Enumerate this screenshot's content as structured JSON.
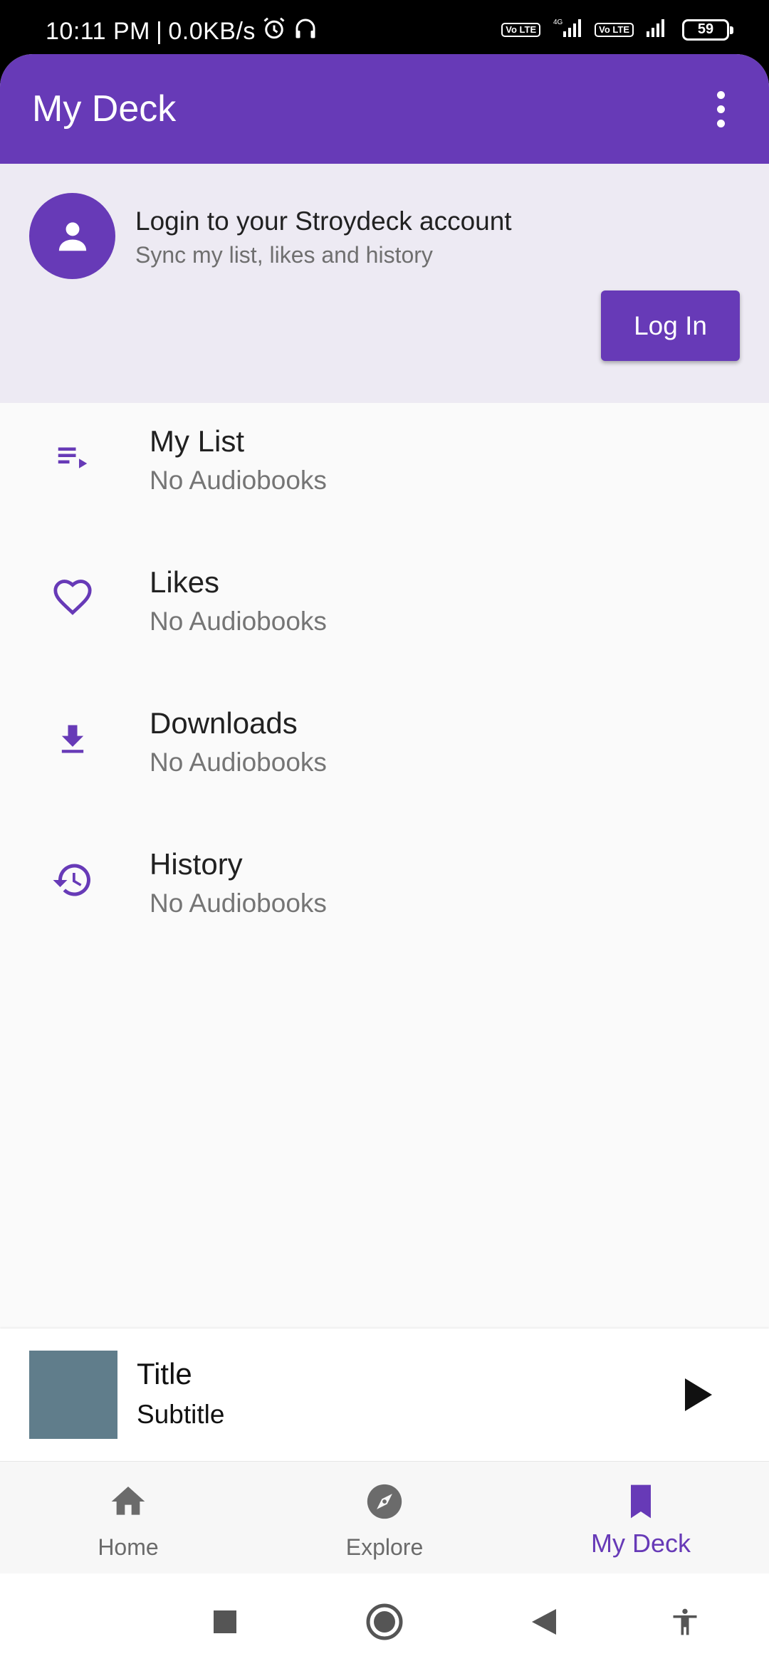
{
  "status_bar": {
    "time": "10:11 PM",
    "separator": "|",
    "net_speed": "0.0KB/s",
    "lte1": "Vo LTE",
    "net_type": "4G",
    "lte2": "Vo LTE",
    "battery": "59"
  },
  "app_bar": {
    "title": "My Deck",
    "menu_icon": "more-vert-icon"
  },
  "login_card": {
    "title": "Login to your Stroydeck account",
    "subtitle": "Sync my list, likes and history",
    "button_label": "Log In"
  },
  "menu": {
    "items": [
      {
        "label": "My List",
        "sub": "No Audiobooks",
        "icon": "playlist-play-icon"
      },
      {
        "label": "Likes",
        "sub": "No Audiobooks",
        "icon": "heart-outline-icon"
      },
      {
        "label": "Downloads",
        "sub": "No Audiobooks",
        "icon": "download-icon"
      },
      {
        "label": "History",
        "sub": "No Audiobooks",
        "icon": "history-icon"
      }
    ]
  },
  "mini_player": {
    "title": "Title",
    "subtitle": "Subtitle",
    "art_color": "#607d8b"
  },
  "bottom_nav": {
    "items": [
      {
        "label": "Home",
        "icon": "home-icon",
        "active": false
      },
      {
        "label": "Explore",
        "icon": "compass-icon",
        "active": false
      },
      {
        "label": "My Deck",
        "icon": "bookmark-icon",
        "active": true
      }
    ]
  },
  "colors": {
    "accent": "#673ab7",
    "login_bg": "#edeaf3",
    "page_bg": "#fafafa"
  }
}
